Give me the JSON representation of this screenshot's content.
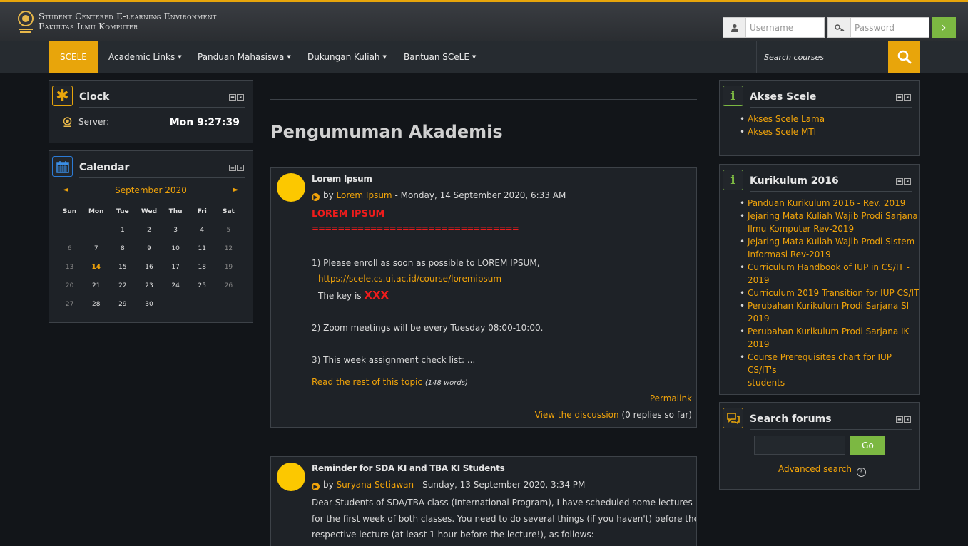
{
  "header": {
    "brand_line1": "Student Centered E-learning Environment",
    "brand_line2": "Fakultas Ilmu Komputer",
    "username_placeholder": "Username",
    "password_placeholder": "Password",
    "accent": "#e8a50b",
    "go_color": "#7cb842"
  },
  "nav": {
    "items": [
      {
        "label": "SCELE"
      },
      {
        "label": "Academic Links"
      },
      {
        "label": "Panduan Mahasiswa"
      },
      {
        "label": "Dukungan Kuliah"
      },
      {
        "label": "Bantuan SCeLE"
      }
    ],
    "search_placeholder": "Search courses"
  },
  "clock": {
    "title": "Clock",
    "server_label": "Server:",
    "time": "Mon 9:27:39"
  },
  "calendar": {
    "title": "Calendar",
    "month": "September 2020",
    "prev": "◄",
    "next": "►",
    "days": [
      "Sun",
      "Mon",
      "Tue",
      "Wed",
      "Thu",
      "Fri",
      "Sat"
    ],
    "weeks": [
      [
        "",
        "",
        "1",
        "2",
        "3",
        "4",
        "5"
      ],
      [
        "6",
        "7",
        "8",
        "9",
        "10",
        "11",
        "12"
      ],
      [
        "13",
        "14",
        "15",
        "16",
        "17",
        "18",
        "19"
      ],
      [
        "20",
        "21",
        "22",
        "23",
        "24",
        "25",
        "26"
      ],
      [
        "27",
        "28",
        "29",
        "30",
        "",
        "",
        ""
      ]
    ],
    "today": "14"
  },
  "main": {
    "page_title": "Pengumuman Akademis",
    "posts": [
      {
        "subject": "Lorem Ipsum",
        "by": "by",
        "author": "Lorem Ipsum",
        "date": "- Monday, 14 September 2020, 6:33 AM",
        "heading": "LOREM IPSUM",
        "rule": "================================",
        "line1": "1) Please enroll as soon as possible to LOREM IPSUM,",
        "link": "https://scele.cs.ui.ac.id/course/loremipsum",
        "key_label": "The key is",
        "key_value": "XXX",
        "line2": "2) Zoom meetings will be every Tuesday 08:00-10:00.",
        "line3": "3) This week assignment check list: ...",
        "read_more": "Read the rest of this topic",
        "word_count": "(148 words)",
        "permalink": "Permalink",
        "view_discussion": "View the discussion",
        "replies": "(0 replies so far)"
      },
      {
        "subject": "Reminder for SDA KI and TBA KI Students",
        "by": "by",
        "author": "Suryana Setiawan",
        "date": "- Sunday, 13 September 2020, 3:34 PM",
        "body1": "Dear Students of SDA/TBA class (International Program), I have scheduled some lectures via Zoom",
        "body2": "for the first week of both classes. You need to do several things (if you haven't) before the",
        "body3": "respective lecture (at least 1 hour before the lecture!), as follows:"
      }
    ]
  },
  "akses": {
    "title": "Akses Scele",
    "links": [
      "Akses Scele Lama",
      "Akses Scele MTI"
    ]
  },
  "kurikulum": {
    "title": "Kurikulum 2016",
    "links": [
      [
        "Panduan Kurikulum 2016 - Rev. 2019"
      ],
      [
        "Jejaring Mata Kuliah Wajib Prodi Sarjana",
        "Ilmu Komputer Rev-2019"
      ],
      [
        "Jejaring Mata Kuliah Wajib Prodi Sistem",
        "Informasi Rev-2019"
      ],
      [
        "Curriculum Handbook of IUP in CS/IT -",
        "2019"
      ],
      [
        "Curriculum 2019 Transition for IUP CS/IT"
      ],
      [
        "Perubahan Kurikulum Prodi Sarjana SI",
        "2019"
      ],
      [
        "Perubahan Kurikulum Prodi Sarjana IK",
        "2019"
      ],
      [
        "Course Prerequisites chart for IUP CS/IT's",
        "students"
      ]
    ]
  },
  "search_forums": {
    "title": "Search forums",
    "go": "Go",
    "advanced": "Advanced search"
  }
}
